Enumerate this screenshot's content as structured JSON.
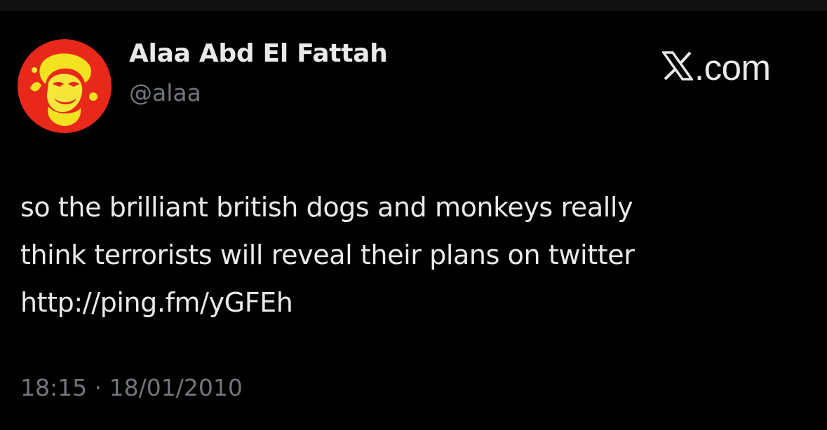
{
  "tweet": {
    "author": {
      "display_name": "Alaa Abd El Fattah",
      "handle": "@alaa",
      "avatar_icon": "avatar-photo"
    },
    "brand": {
      "logo_icon": "x-logo-icon",
      "suffix": ".com"
    },
    "text_lines": [
      "so the brilliant british dogs and monkeys really",
      "think terrorists will reveal their plans on twitter",
      "http://ping.fm/yGFEh"
    ],
    "time": "18:15",
    "separator": "·",
    "date": "18/01/2010"
  },
  "colors": {
    "background": "#000000",
    "primary_text": "#E7E9EA",
    "secondary_text": "#71767B",
    "avatar_red": "#E8281A",
    "avatar_yellow": "#F2E21F"
  }
}
